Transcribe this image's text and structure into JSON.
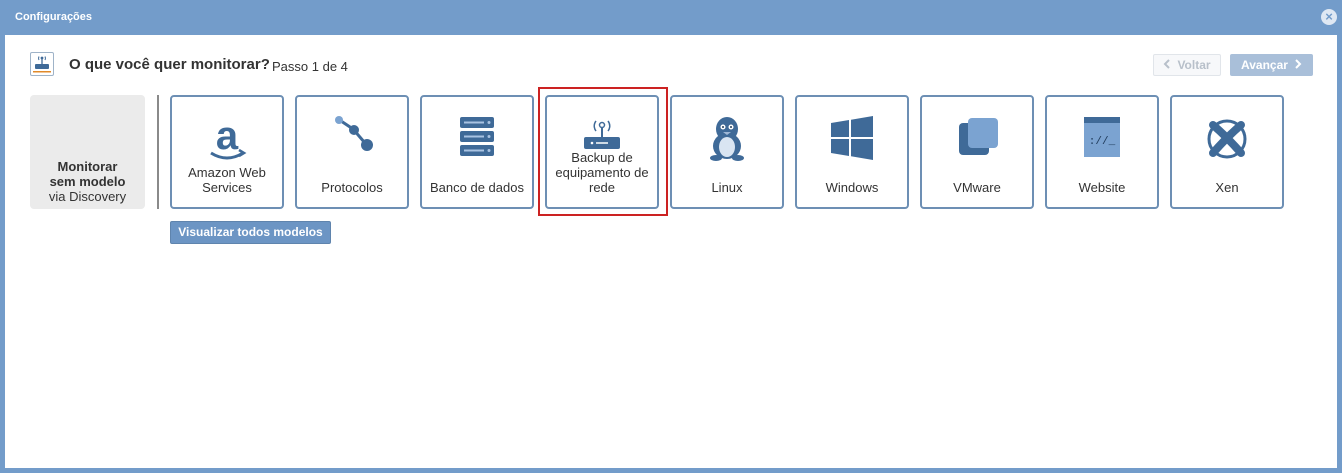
{
  "window": {
    "title": "Configurações"
  },
  "header": {
    "question": "O que você quer monitorar?",
    "step": "Passo 1 de 4",
    "back_label": "Voltar",
    "next_label": "Avançar"
  },
  "no_model": {
    "line1": "Monitorar",
    "line2": "sem modelo",
    "line3": "via Discovery"
  },
  "tiles": [
    {
      "label": "Amazon Web Services",
      "icon": "amazon-icon"
    },
    {
      "label": "Protocolos",
      "icon": "protocols-icon"
    },
    {
      "label": "Banco de dados",
      "icon": "database-icon"
    },
    {
      "label": "Backup de equipamento de rede",
      "icon": "router-icon",
      "highlighted": true
    },
    {
      "label": "Linux",
      "icon": "linux-icon"
    },
    {
      "label": "Windows",
      "icon": "windows-icon"
    },
    {
      "label": "VMware",
      "icon": "vmware-icon"
    },
    {
      "label": "Website",
      "icon": "website-icon"
    },
    {
      "label": "Xen",
      "icon": "xen-icon"
    }
  ],
  "view_all_label": "Visualizar todos modelos",
  "colors": {
    "titlebar": "#739cca",
    "tile_border": "#6d8fb4",
    "icon": "#3f6a98",
    "highlight": "#cc2222"
  }
}
